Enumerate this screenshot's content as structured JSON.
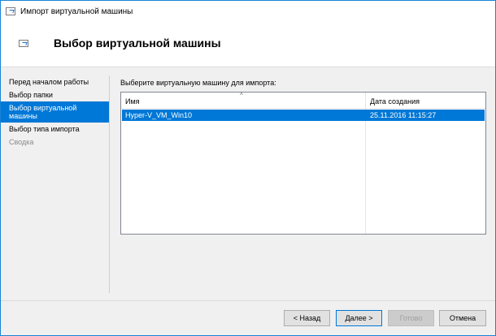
{
  "window": {
    "title": "Импорт виртуальной машины"
  },
  "header": {
    "title": "Выбор виртуальной машины"
  },
  "nav": {
    "items": [
      {
        "label": "Перед началом работы",
        "state": "normal"
      },
      {
        "label": "Выбор папки",
        "state": "normal"
      },
      {
        "label": "Выбор виртуальной машины",
        "state": "selected"
      },
      {
        "label": "Выбор типа импорта",
        "state": "normal"
      },
      {
        "label": "Сводка",
        "state": "disabled"
      }
    ]
  },
  "main": {
    "prompt": "Выберите виртуальную машину для импорта:",
    "columns": [
      "Имя",
      "Дата создания"
    ],
    "rows": [
      {
        "name": "Hyper-V_VM_Win10",
        "created": "25.11.2016 11:15:27"
      }
    ]
  },
  "footer": {
    "back": "< Назад",
    "next": "Далее >",
    "finish": "Готово",
    "cancel": "Отмена"
  },
  "colors": {
    "accent": "#0078d7"
  }
}
